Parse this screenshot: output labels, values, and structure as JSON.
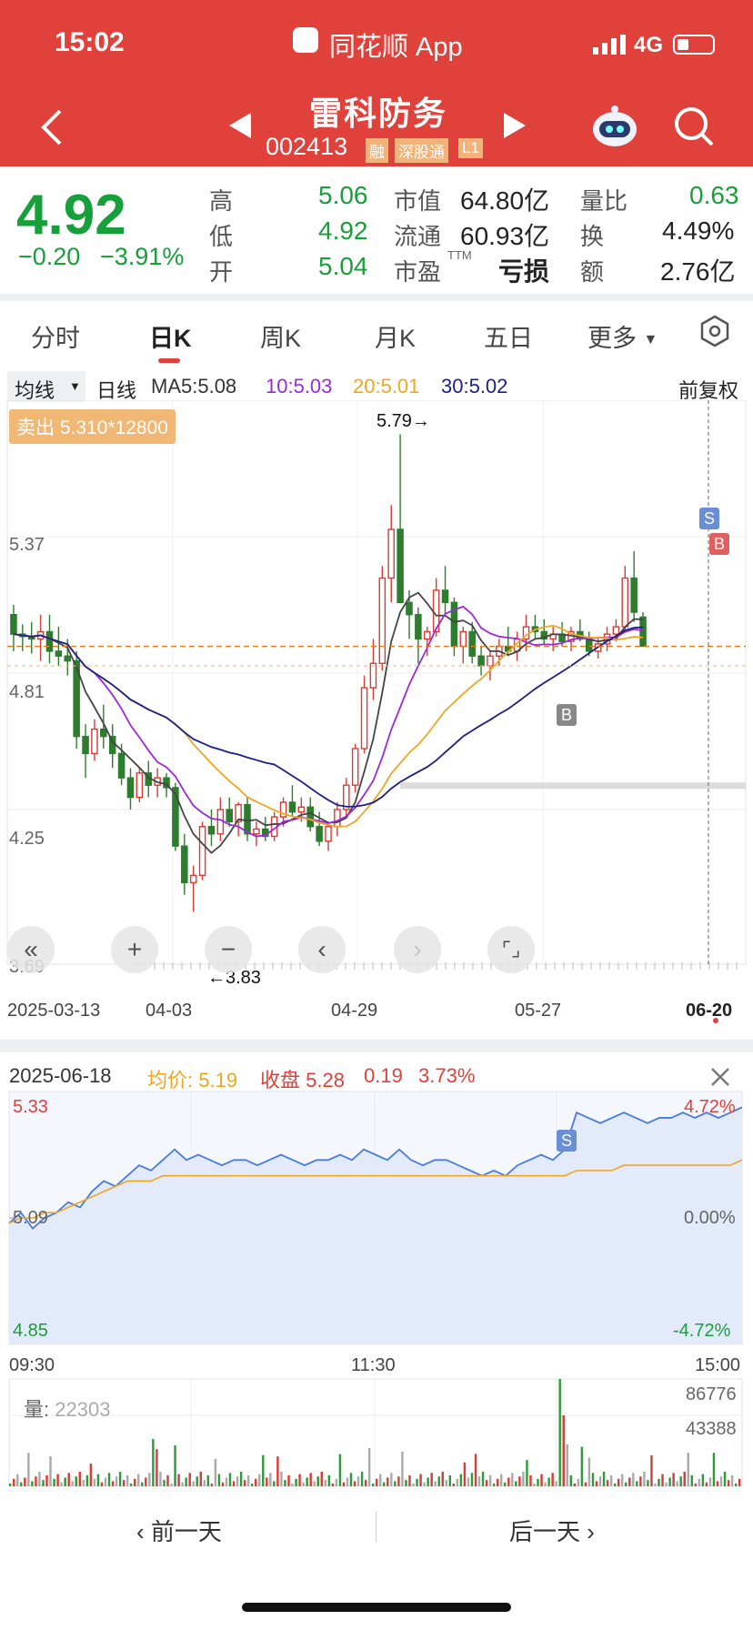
{
  "status_bar": {
    "time": "15:02",
    "app_name": "同花顺 App",
    "network": "4G"
  },
  "header": {
    "stock_name": "雷科防务",
    "stock_code": "002413",
    "tags": [
      "融",
      "深股通",
      "L1"
    ]
  },
  "quote": {
    "price": "4.92",
    "change": "−0.20",
    "change_pct": "−3.91%",
    "rows": [
      {
        "l1": "高",
        "v1": "5.06",
        "l2": "市值",
        "v2": "64.80亿",
        "l3": "量比",
        "v3": "0.63"
      },
      {
        "l1": "低",
        "v1": "4.92",
        "l2": "流通",
        "v2": "60.93亿",
        "l3": "换",
        "v3": "4.49%"
      },
      {
        "l1": "开",
        "v1": "5.04",
        "l2": "市盈",
        "l2sup": "TTM",
        "v2": "亏损",
        "l3": "额",
        "v3": "2.76亿"
      }
    ]
  },
  "tabs": [
    "分时",
    "日K",
    "周K",
    "月K",
    "五日",
    "更多"
  ],
  "active_tab": "日K",
  "ma_bar": {
    "selector": "均线",
    "period": "日线",
    "ma5": "MA5:5.08",
    "ma10": "10:5.03",
    "ma20": "20:5.01",
    "ma30": "30:5.02",
    "adjust": "前复权"
  },
  "kline": {
    "order_label": "卖出 5.310*12800",
    "y_labels": [
      "5.37",
      "4.81",
      "4.25",
      "3.69"
    ],
    "high_label": "5.79→",
    "low_label": "←3.83",
    "x_labels": [
      "2025-03-13",
      "04-03",
      "04-29",
      "05-27",
      "06-20"
    ],
    "marker_s": "S",
    "marker_b": "B"
  },
  "chart_data": [
    {
      "type": "candlestick",
      "title": "日K",
      "ylim": [
        3.69,
        5.93
      ],
      "candles_ohlc": [
        [
          5.05,
          5.09,
          4.9,
          4.97
        ],
        [
          4.97,
          5.01,
          4.9,
          4.96
        ],
        [
          4.96,
          5.02,
          4.89,
          4.95
        ],
        [
          4.95,
          5.05,
          4.86,
          4.98
        ],
        [
          4.98,
          5.05,
          4.85,
          4.9
        ],
        [
          4.9,
          5.0,
          4.84,
          4.88
        ],
        [
          4.88,
          4.95,
          4.8,
          4.86
        ],
        [
          4.86,
          4.9,
          4.5,
          4.55
        ],
        [
          4.55,
          4.6,
          4.38,
          4.48
        ],
        [
          4.48,
          4.62,
          4.45,
          4.58
        ],
        [
          4.58,
          4.68,
          4.5,
          4.55
        ],
        [
          4.55,
          4.6,
          4.42,
          4.48
        ],
        [
          4.48,
          4.52,
          4.35,
          4.38
        ],
        [
          4.38,
          4.42,
          4.25,
          4.3
        ],
        [
          4.3,
          4.42,
          4.28,
          4.4
        ],
        [
          4.4,
          4.45,
          4.3,
          4.35
        ],
        [
          4.35,
          4.42,
          4.3,
          4.38
        ],
        [
          4.38,
          4.4,
          4.3,
          4.34
        ],
        [
          4.34,
          4.36,
          4.08,
          4.1
        ],
        [
          4.1,
          4.15,
          3.9,
          3.95
        ],
        [
          3.95,
          4.02,
          3.83,
          3.98
        ],
        [
          3.98,
          4.2,
          3.96,
          4.18
        ],
        [
          4.18,
          4.25,
          4.1,
          4.15
        ],
        [
          4.15,
          4.3,
          4.12,
          4.25
        ],
        [
          4.25,
          4.3,
          4.18,
          4.2
        ],
        [
          4.2,
          4.28,
          4.14,
          4.27
        ],
        [
          4.27,
          4.3,
          4.12,
          4.15
        ],
        [
          4.15,
          4.2,
          4.1,
          4.17
        ],
        [
          4.17,
          4.22,
          4.12,
          4.14
        ],
        [
          4.14,
          4.24,
          4.12,
          4.22
        ],
        [
          4.22,
          4.3,
          4.18,
          4.28
        ],
        [
          4.28,
          4.35,
          4.22,
          4.24
        ],
        [
          4.24,
          4.3,
          4.2,
          4.26
        ],
        [
          4.26,
          4.3,
          4.16,
          4.18
        ],
        [
          4.18,
          4.24,
          4.1,
          4.12
        ],
        [
          4.12,
          4.2,
          4.08,
          4.18
        ],
        [
          4.18,
          4.28,
          4.14,
          4.25
        ],
        [
          4.25,
          4.38,
          4.22,
          4.35
        ],
        [
          4.35,
          4.52,
          4.32,
          4.5
        ],
        [
          4.5,
          4.8,
          4.48,
          4.75
        ],
        [
          4.75,
          4.95,
          4.7,
          4.85
        ],
        [
          4.85,
          5.25,
          4.82,
          5.2
        ],
        [
          5.2,
          5.5,
          5.1,
          5.4
        ],
        [
          5.4,
          5.79,
          5.3,
          5.1
        ],
        [
          5.1,
          5.15,
          4.95,
          5.05
        ],
        [
          5.05,
          5.08,
          4.85,
          4.95
        ],
        [
          4.95,
          5.0,
          4.88,
          4.98
        ],
        [
          4.98,
          5.2,
          4.96,
          5.15
        ],
        [
          5.15,
          5.25,
          5.05,
          5.1
        ],
        [
          5.1,
          5.12,
          4.88,
          4.92
        ],
        [
          4.92,
          5.0,
          4.85,
          4.98
        ],
        [
          4.98,
          5.02,
          4.85,
          4.88
        ],
        [
          4.88,
          4.92,
          4.8,
          4.84
        ],
        [
          4.84,
          4.9,
          4.78,
          4.88
        ],
        [
          4.88,
          4.95,
          4.84,
          4.92
        ],
        [
          4.92,
          5.0,
          4.88,
          4.9
        ],
        [
          4.9,
          4.98,
          4.86,
          4.95
        ],
        [
          4.95,
          5.05,
          4.9,
          5.0
        ],
        [
          5.0,
          5.05,
          4.95,
          4.98
        ],
        [
          4.98,
          5.03,
          4.93,
          4.95
        ],
        [
          4.95,
          5.0,
          4.9,
          4.97
        ],
        [
          4.97,
          5.02,
          4.92,
          4.94
        ],
        [
          4.94,
          5.0,
          4.9,
          4.98
        ],
        [
          4.98,
          5.03,
          4.94,
          4.95
        ],
        [
          4.95,
          4.98,
          4.88,
          4.9
        ],
        [
          4.9,
          4.96,
          4.87,
          4.93
        ],
        [
          4.93,
          5.0,
          4.9,
          4.97
        ],
        [
          4.97,
          5.03,
          4.94,
          5.0
        ],
        [
          5.0,
          5.25,
          4.98,
          5.2
        ],
        [
          5.2,
          5.31,
          5.02,
          5.06
        ],
        [
          5.04,
          5.06,
          4.92,
          4.92
        ]
      ]
    },
    {
      "type": "line",
      "title": "分时",
      "date": "2025-06-18",
      "avg_price": "5.19",
      "close": "5.28",
      "change": "0.19",
      "change_pct": "3.73%",
      "y_labels": [
        "5.33",
        "5.09",
        "4.85"
      ],
      "pct_labels": [
        "4.72%",
        "0.00%",
        "-4.72%"
      ],
      "x_labels": [
        "09:30",
        "11:30",
        "15:00"
      ],
      "ylim": [
        4.85,
        5.33
      ],
      "series": [
        {
          "name": "price",
          "values": [
            5.08,
            5.1,
            5.07,
            5.09,
            5.1,
            5.12,
            5.11,
            5.14,
            5.16,
            5.15,
            5.17,
            5.19,
            5.18,
            5.2,
            5.22,
            5.2,
            5.21,
            5.2,
            5.19,
            5.2,
            5.2,
            5.19,
            5.2,
            5.21,
            5.2,
            5.19,
            5.2,
            5.2,
            5.21,
            5.2,
            5.22,
            5.21,
            5.2,
            5.22,
            5.2,
            5.19,
            5.2,
            5.2,
            5.19,
            5.18,
            5.17,
            5.18,
            5.17,
            5.19,
            5.2,
            5.21,
            5.2,
            5.22,
            5.29,
            5.28,
            5.27,
            5.28,
            5.29,
            5.28,
            5.27,
            5.28,
            5.28,
            5.29,
            5.28,
            5.29,
            5.28,
            5.29,
            5.3
          ]
        },
        {
          "name": "均价",
          "values": [
            5.08,
            5.09,
            5.09,
            5.1,
            5.1,
            5.11,
            5.12,
            5.13,
            5.14,
            5.15,
            5.16,
            5.16,
            5.16,
            5.17,
            5.17,
            5.17,
            5.17,
            5.17,
            5.17,
            5.17,
            5.17,
            5.17,
            5.17,
            5.17,
            5.17,
            5.17,
            5.17,
            5.17,
            5.17,
            5.17,
            5.17,
            5.17,
            5.17,
            5.17,
            5.17,
            5.17,
            5.17,
            5.17,
            5.17,
            5.17,
            5.17,
            5.17,
            5.17,
            5.17,
            5.17,
            5.17,
            5.17,
            5.17,
            5.18,
            5.18,
            5.18,
            5.18,
            5.19,
            5.19,
            5.19,
            5.19,
            5.19,
            5.19,
            5.19,
            5.19,
            5.19,
            5.19,
            5.2
          ]
        }
      ],
      "volume": {
        "label": "量:",
        "value": "22303",
        "y_labels": [
          "86776",
          "43388"
        ]
      }
    }
  ],
  "nav": {
    "prev": "前一天",
    "next": "后一天"
  }
}
